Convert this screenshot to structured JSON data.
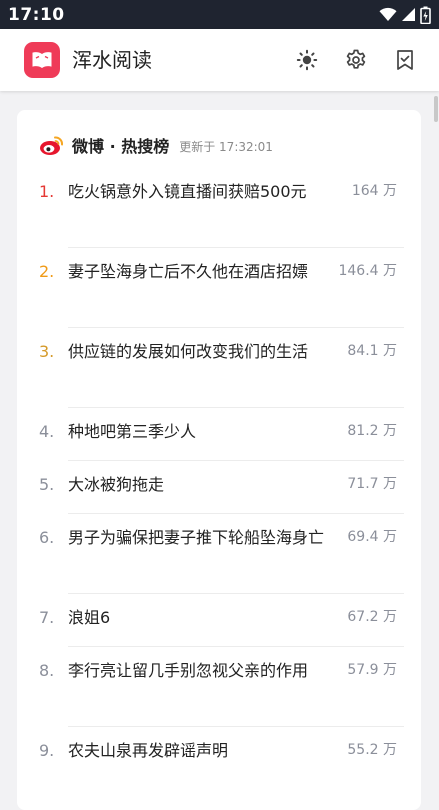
{
  "status_bar": {
    "time": "17:10"
  },
  "app": {
    "title": "浑水阅读"
  },
  "card": {
    "source_label": "微博 · 热搜榜",
    "updated_text": "更新于 17:32:01",
    "items": [
      {
        "rank": "1.",
        "title": "吃火锅意外入镜直播间获赔500元",
        "heat": "164 万"
      },
      {
        "rank": "2.",
        "title": "妻子坠海身亡后不久他在酒店招嫖",
        "heat": "146.4 万"
      },
      {
        "rank": "3.",
        "title": "供应链的发展如何改变我们的生活",
        "heat": "84.1 万"
      },
      {
        "rank": "4.",
        "title": "种地吧第三季少人",
        "heat": "81.2 万"
      },
      {
        "rank": "5.",
        "title": "大冰被狗拖走",
        "heat": "71.7 万"
      },
      {
        "rank": "6.",
        "title": "男子为骗保把妻子推下轮船坠海身亡",
        "heat": "69.4 万"
      },
      {
        "rank": "7.",
        "title": "浪姐6",
        "heat": "67.2 万"
      },
      {
        "rank": "8.",
        "title": "李行亮让留几手别忽视父亲的作用",
        "heat": "57.9 万"
      },
      {
        "rank": "9.",
        "title": "农夫山泉再发辟谣声明",
        "heat": "55.2 万"
      }
    ]
  },
  "colors": {
    "brand": "#ef3b58",
    "rank1": "#e53935",
    "rank2": "#f09a16",
    "rank3": "#d59a2a",
    "rank_default": "#8b8f9a"
  },
  "icons": {
    "status": [
      "wifi-icon",
      "signal-icon",
      "battery-icon"
    ],
    "appbar": [
      "brightness-icon",
      "settings-icon",
      "bookmark-icon"
    ]
  }
}
